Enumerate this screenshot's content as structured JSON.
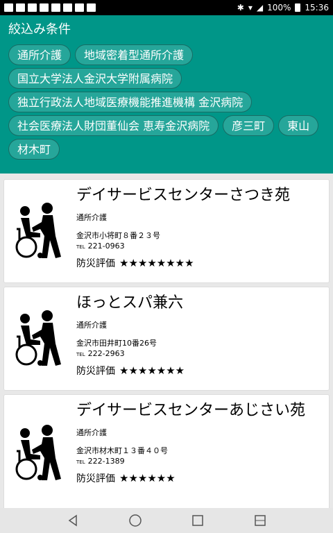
{
  "status": {
    "battery": "100%",
    "time": "15:36"
  },
  "filter": {
    "title": "絞込み条件",
    "chips": [
      "通所介護",
      "地域密着型通所介護",
      "国立大学法人金沢大学附属病院",
      "独立行政法人地域医療機能推進機構 金沢病院",
      "社会医療法人財団董仙会 恵寿金沢病院",
      "彦三町",
      "東山",
      "材木町"
    ]
  },
  "rating_label": "防災評価",
  "facilities": [
    {
      "name": "デイサービスセンターさつき苑",
      "category": "通所介護",
      "address": "金沢市小将町８番２３号",
      "tel_icon": "TEL",
      "tel": "221-0963",
      "stars": "★★★★★★★★"
    },
    {
      "name": "ほっとスパ兼六",
      "category": "通所介護",
      "address": "金沢市田井町10番26号",
      "tel_icon": "TEL",
      "tel": "222-2963",
      "stars": "★★★★★★★"
    },
    {
      "name": "デイサービスセンターあじさい苑",
      "category": "通所介護",
      "address": "金沢市材木町１３番４０号",
      "tel_icon": "TEL",
      "tel": "222-1389",
      "stars": "★★★★★★"
    }
  ],
  "icons": {
    "facility": "wheelchair-caregiver-icon"
  }
}
